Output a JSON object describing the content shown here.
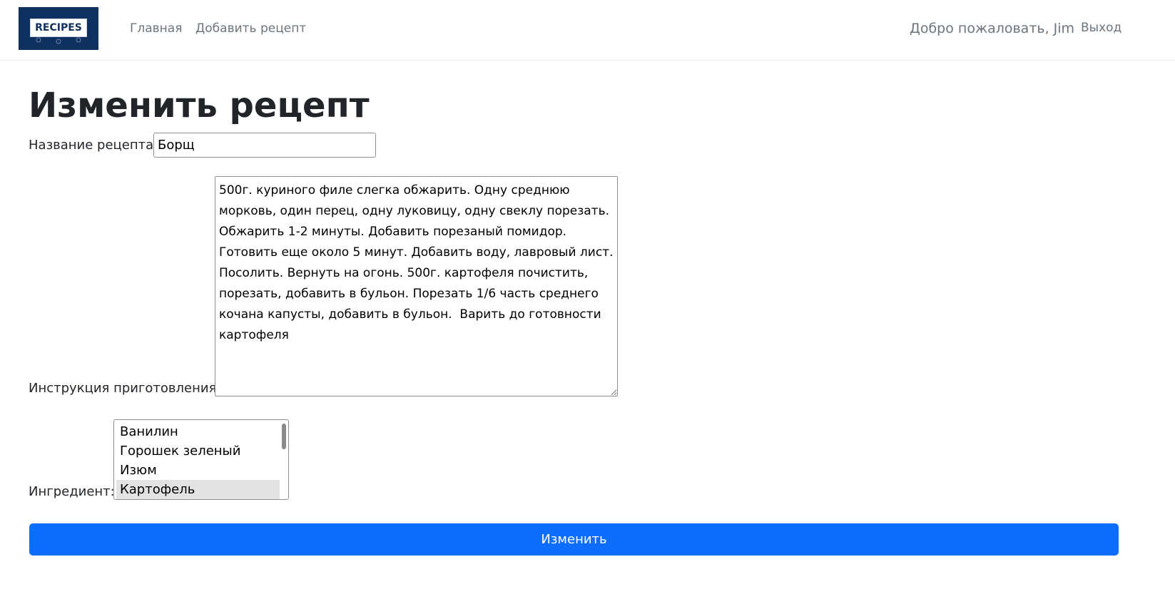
{
  "navbar": {
    "brand_text": "RECIPES",
    "links": [
      {
        "label": "Главная"
      },
      {
        "label": "Добавить рецепт"
      }
    ],
    "welcome": "Добро пожаловать, Jim",
    "logout": "Выход"
  },
  "page": {
    "title": "Изменить рецепт"
  },
  "form": {
    "name_label": "Название рецепта:",
    "name_value": "Борщ",
    "instructions_label": "Инструкция приготовления:",
    "instructions_value": "500г. куриного филе слегка обжарить. Одну среднюю морковь, один перец, одну луковицу, одну свеклу порезать. Обжарить 1-2 минуты. Добавить порезаный помидор. Готовить еще около 5 минут. Добавить воду, лавровый лист. Посолить. Вернуть на огонь. 500г. картофеля почистить, порезать, добавить в бульон. Порезать 1/6 часть среднего кочана капусты, добавить в бульон.  Варить до готовности картофеля",
    "ingredient_label": "Ингредиент:",
    "ingredient_options": [
      "Ванилин",
      "Горошек зеленый",
      "Изюм",
      "Картофель"
    ],
    "ingredient_selected": "Картофель",
    "submit_label": "Изменить"
  },
  "colors": {
    "primary": "#0d6efd",
    "brand_bg": "#0f3160",
    "nav_text": "#6c757d"
  }
}
